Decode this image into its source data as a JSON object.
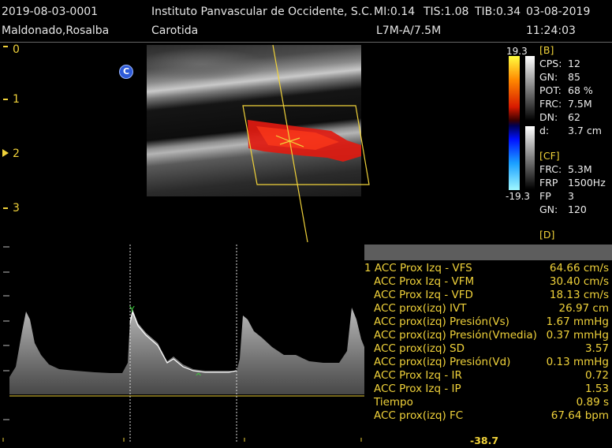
{
  "header": {
    "exam_id": "2019-08-03-0001",
    "institution": "Instituto Panvascular de Occidente, S.C.",
    "mi": "MI:0.14",
    "tis": "TIS:1.08",
    "tib": "TIB:0.34",
    "date": "03-08-2019",
    "patient": "Maldonado,Rosalba",
    "study": "Carotida",
    "probe": "L7M-A/7.5M",
    "time": "11:24:03"
  },
  "depth_scale": [
    "0",
    "1",
    "2",
    "3"
  ],
  "c_badge": "C",
  "colorbar": {
    "max": "19.3",
    "min": "-19.3"
  },
  "b_params": {
    "section": "[B]",
    "rows": [
      {
        "key": "CPS:",
        "value": "12"
      },
      {
        "key": "GN:",
        "value": "85"
      },
      {
        "key": "POT:",
        "value": "68 %"
      },
      {
        "key": "FRC:",
        "value": "7.5M"
      },
      {
        "key": "DN:",
        "value": "62"
      },
      {
        "key": "d:",
        "value": "3.7 cm"
      }
    ]
  },
  "cf_params": {
    "section": "[CF]",
    "rows": [
      {
        "key": "FRC:",
        "value": "5.3M"
      },
      {
        "key": "FRP",
        "value": "1500Hz"
      },
      {
        "key": "FP",
        "value": "3"
      },
      {
        "key": "GN:",
        "value": "120"
      }
    ]
  },
  "d_params": {
    "section": "[D]"
  },
  "measurements": [
    {
      "label": "1 ACC Prox Izq - VFS",
      "value": "64.66 cm/s"
    },
    {
      "label": "ACC Prox Izq - VFM",
      "value": "30.40 cm/s"
    },
    {
      "label": "ACC Prox Izq - VFD",
      "value": "18.13 cm/s"
    },
    {
      "label": "ACC prox(izq) IVT",
      "value": "26.97 cm"
    },
    {
      "label": "ACC prox(izq) Presión(Vs)",
      "value": "1.67 mmHg"
    },
    {
      "label": "ACC prox(izq) Presión(Vmedia)",
      "value": "0.37 mmHg"
    },
    {
      "label": "ACC prox(izq) SD",
      "value": "3.57"
    },
    {
      "label": "ACC prox(izq) Presión(Vd)",
      "value": "0.13 mmHg"
    },
    {
      "label": "ACC Prox Izq - IR",
      "value": "0.72"
    },
    {
      "label": "ACC Prox Izq - IP",
      "value": "1.53"
    },
    {
      "label": "Tiempo",
      "value": "0.89 s"
    },
    {
      "label": "ACC prox(izq) FC",
      "value": "67.64 bpm"
    }
  ],
  "velocity_bottom": "-38.7",
  "colors": {
    "accent_yellow": "#f0d23a",
    "doppler_red": "#e01a10",
    "marker_green": "#3cd23c"
  }
}
